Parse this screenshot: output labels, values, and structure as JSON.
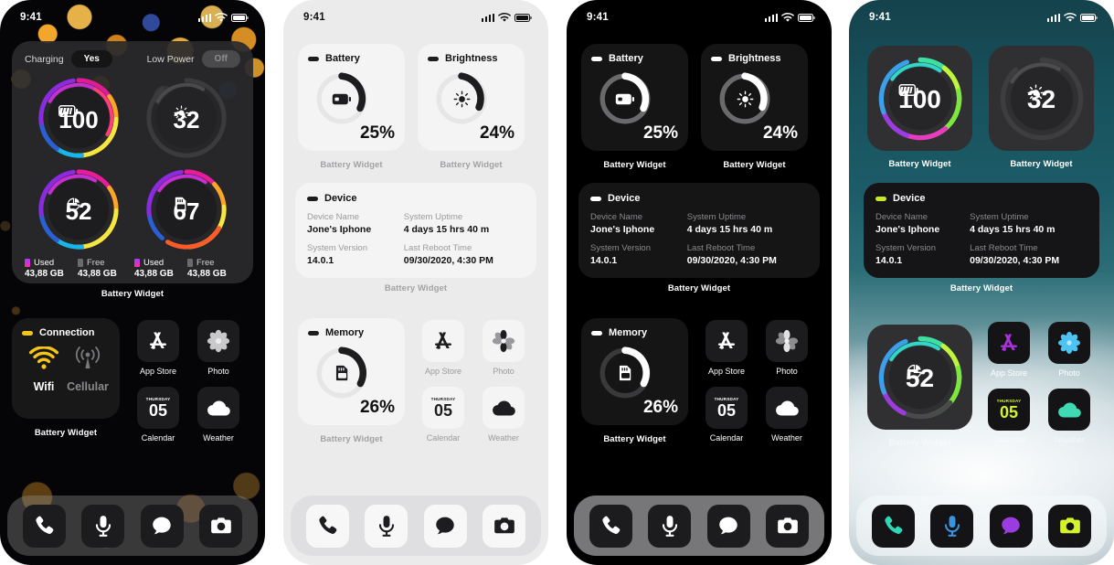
{
  "meta": {
    "screens": 4,
    "app_name": "Battery Widget"
  },
  "status_bar": {
    "time": "9:41",
    "cellular_icon": "cellular-bars-icon",
    "wifi_icon": "wifi-icon",
    "battery_icon": "battery-icon"
  },
  "labels": {
    "widget_caption": "Battery Widget"
  },
  "phone1": {
    "theme": "bokeh-wallpaper",
    "battery_widget": {
      "charging_label": "Charging",
      "charging_value": "Yes",
      "low_power_label": "Low Power",
      "low_power_value": "Off",
      "gauges": [
        {
          "icon": "battery-full-icon",
          "value": "100",
          "ring": "rainbow"
        },
        {
          "icon": "brightness-sun-icon",
          "value": "32",
          "ring": "grey"
        },
        {
          "icon": "pie-chart-icon",
          "value": "52",
          "ring": "rainbow"
        },
        {
          "icon": "memory-card-icon",
          "value": "67",
          "ring": "rainbow"
        }
      ],
      "legend": [
        {
          "name": "Used",
          "value": "43,88 GB",
          "color": "#b03cff"
        },
        {
          "name": "Free",
          "value": "43,88 GB",
          "color": "#6b6b6e"
        },
        {
          "name": "Used",
          "value": "43,88 GB",
          "color": "#b03cff"
        },
        {
          "name": "Free",
          "value": "43,88 GB",
          "color": "#6b6b6e"
        }
      ],
      "caption": "Battery Widget"
    },
    "connection_widget": {
      "title": "Connection",
      "dot_color": "#f5c518",
      "items": [
        {
          "icon": "wifi-icon",
          "name": "Wifi",
          "active": true
        },
        {
          "icon": "cellular-tower-icon",
          "name": "Cellular",
          "active": false
        }
      ],
      "caption": "Battery Widget"
    },
    "apps": [
      {
        "icon": "app-store-icon",
        "name": "App Store"
      },
      {
        "icon": "photos-icon",
        "name": "Photo"
      },
      {
        "icon": "calendar-icon",
        "name": "Calendar",
        "weekday": "THURSDAY",
        "day": "05"
      },
      {
        "icon": "weather-cloud-icon",
        "name": "Weather"
      }
    ],
    "dock": [
      {
        "icon": "phone-icon",
        "name": "Phone"
      },
      {
        "icon": "microphone-icon",
        "name": "Voice Memos"
      },
      {
        "icon": "message-bubble-icon",
        "name": "Messages"
      },
      {
        "icon": "camera-icon",
        "name": "Camera"
      }
    ]
  },
  "phone2": {
    "theme": "light",
    "small_widgets": [
      {
        "title": "Battery",
        "icon": "battery-icon",
        "percent": "25%",
        "arc": 27
      },
      {
        "title": "Brightness",
        "icon": "brightness-sun-icon",
        "percent": "24%",
        "arc": 25
      }
    ],
    "captions": [
      "Battery Widget",
      "Battery Widget"
    ],
    "device_widget": {
      "title": "Device",
      "caption": "Battery Widget",
      "fields": [
        {
          "key": "Device Name",
          "value": "Jone's Iphone"
        },
        {
          "key": "System Uptime",
          "value": "4 days 15 hrs 40 m"
        },
        {
          "key": "System Version",
          "value": "14.0.1"
        },
        {
          "key": "Last Reboot Time",
          "value": "09/30/2020, 4:30 PM"
        }
      ]
    },
    "memory_widget": {
      "title": "Memory",
      "icon": "memory-card-icon",
      "percent": "26%",
      "arc": 28,
      "caption": "Battery Widget"
    },
    "apps": [
      {
        "icon": "app-store-icon",
        "name": "App Store"
      },
      {
        "icon": "photos-icon",
        "name": "Photo"
      },
      {
        "icon": "calendar-icon",
        "name": "Calendar",
        "weekday": "THURSDAY",
        "day": "05"
      },
      {
        "icon": "weather-cloud-icon",
        "name": "Weather"
      }
    ],
    "dock": [
      {
        "icon": "phone-icon",
        "name": "Phone"
      },
      {
        "icon": "microphone-icon",
        "name": "Voice Memos"
      },
      {
        "icon": "message-bubble-icon",
        "name": "Messages"
      },
      {
        "icon": "camera-icon",
        "name": "Camera"
      }
    ]
  },
  "phone3": {
    "theme": "dark",
    "small_widgets": [
      {
        "title": "Battery",
        "icon": "battery-icon",
        "percent": "25%",
        "arc": 27
      },
      {
        "title": "Brightness",
        "icon": "brightness-sun-icon",
        "percent": "24%",
        "arc": 25
      }
    ],
    "captions": [
      "Battery Widget",
      "Battery Widget"
    ],
    "device_widget": {
      "title": "Device",
      "caption": "Battery Widget",
      "fields": [
        {
          "key": "Device Name",
          "value": "Jone's Iphone"
        },
        {
          "key": "System Uptime",
          "value": "4 days 15 hrs 40 m"
        },
        {
          "key": "System Version",
          "value": "14.0.1"
        },
        {
          "key": "Last Reboot Time",
          "value": "09/30/2020, 4:30 PM"
        }
      ]
    },
    "memory_widget": {
      "title": "Memory",
      "icon": "memory-card-icon",
      "percent": "26%",
      "arc": 28,
      "caption": "Battery Widget"
    },
    "apps": [
      {
        "icon": "app-store-icon",
        "name": "App Store"
      },
      {
        "icon": "photos-icon",
        "name": "Photo"
      },
      {
        "icon": "calendar-icon",
        "name": "Calendar",
        "weekday": "THURSDAY",
        "day": "05"
      },
      {
        "icon": "weather-cloud-icon",
        "name": "Weather"
      }
    ],
    "dock": [
      {
        "icon": "phone-icon",
        "name": "Phone"
      },
      {
        "icon": "microphone-icon",
        "name": "Voice Memos"
      },
      {
        "icon": "message-bubble-icon",
        "name": "Messages"
      },
      {
        "icon": "camera-icon",
        "name": "Camera"
      }
    ]
  },
  "phone4": {
    "theme": "ocean-wallpaper",
    "gauges": [
      {
        "icon": "battery-full-icon",
        "value": "100",
        "ring": "rainbow",
        "caption": "Battery Widget"
      },
      {
        "icon": "brightness-sun-icon",
        "value": "32",
        "ring": "grey",
        "caption": "Battery Widget"
      }
    ],
    "device_widget": {
      "title": "Device",
      "dot_color": "#c8e62a",
      "caption": "Battery Widget",
      "fields": [
        {
          "key": "Device Name",
          "value": "Jone's Iphone"
        },
        {
          "key": "System Uptime",
          "value": "4 days 15 hrs 40 m"
        },
        {
          "key": "System Version",
          "value": "14.0.1"
        },
        {
          "key": "Last Reboot Time",
          "value": "09/30/2020, 4:30 PM"
        }
      ]
    },
    "pie_widget": {
      "icon": "pie-chart-icon",
      "value": "52",
      "caption": "Battery Widget"
    },
    "apps": [
      {
        "icon": "app-store-icon",
        "name": "App Store",
        "color": "#a832dd"
      },
      {
        "icon": "photos-icon",
        "name": "Photo",
        "color": "#4cc3f0"
      },
      {
        "icon": "calendar-icon",
        "name": "Calendar",
        "weekday": "THURSDAY",
        "day": "05",
        "color": "#d6f32a"
      },
      {
        "icon": "weather-cloud-icon",
        "name": "Weather",
        "color": "#3fd9b4"
      }
    ],
    "dock": [
      {
        "icon": "phone-icon",
        "name": "Phone",
        "color": "#2ed8b6"
      },
      {
        "icon": "microphone-icon",
        "name": "Voice Memos",
        "color": "#3a93e0"
      },
      {
        "icon": "message-bubble-icon",
        "name": "Messages",
        "color": "#9b3ce0"
      },
      {
        "icon": "camera-icon",
        "name": "Camera",
        "color": "#d6f32a"
      }
    ]
  }
}
